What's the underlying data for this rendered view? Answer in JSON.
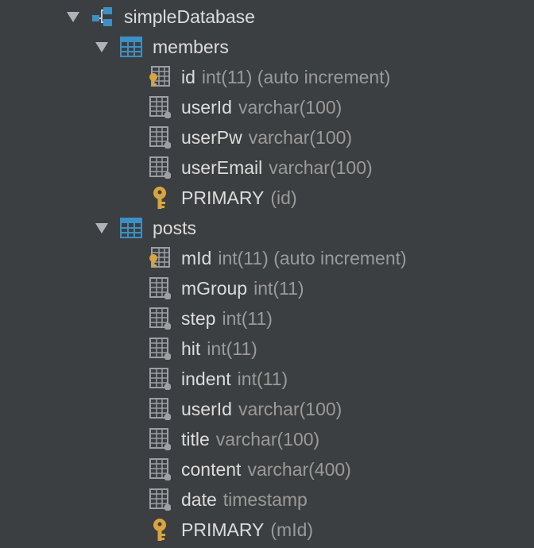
{
  "database": {
    "name": "simpleDatabase"
  },
  "tables": [
    {
      "name": "members",
      "columns": [
        {
          "name": "id",
          "type": "int(11) (auto increment)",
          "icon": "primary-key-column-icon"
        },
        {
          "name": "userId",
          "type": "varchar(100)",
          "icon": "column-icon"
        },
        {
          "name": "userPw",
          "type": "varchar(100)",
          "icon": "column-icon"
        },
        {
          "name": "userEmail",
          "type": "varchar(100)",
          "icon": "column-icon"
        }
      ],
      "keys": [
        {
          "name": "PRIMARY",
          "type": "(id)",
          "icon": "key-icon"
        }
      ]
    },
    {
      "name": "posts",
      "columns": [
        {
          "name": "mId",
          "type": "int(11) (auto increment)",
          "icon": "primary-key-column-icon"
        },
        {
          "name": "mGroup",
          "type": "int(11)",
          "icon": "column-icon"
        },
        {
          "name": "step",
          "type": "int(11)",
          "icon": "column-icon"
        },
        {
          "name": "hit",
          "type": "int(11)",
          "icon": "column-icon"
        },
        {
          "name": "indent",
          "type": "int(11)",
          "icon": "column-icon"
        },
        {
          "name": "userId",
          "type": "varchar(100)",
          "icon": "column-icon"
        },
        {
          "name": "title",
          "type": "varchar(100)",
          "icon": "column-icon"
        },
        {
          "name": "content",
          "type": "varchar(400)",
          "icon": "column-icon"
        },
        {
          "name": "date",
          "type": "timestamp",
          "icon": "column-icon"
        }
      ],
      "keys": [
        {
          "name": "PRIMARY",
          "type": "(mId)",
          "icon": "key-icon"
        }
      ]
    }
  ],
  "colors": {
    "background": "#3c3f41",
    "text": "#dcdcdc",
    "type_text": "#9a9a9a",
    "table_icon": "#3d8fc4",
    "key_icon": "#d9a43f",
    "column_icon": "#9aa0a6"
  }
}
